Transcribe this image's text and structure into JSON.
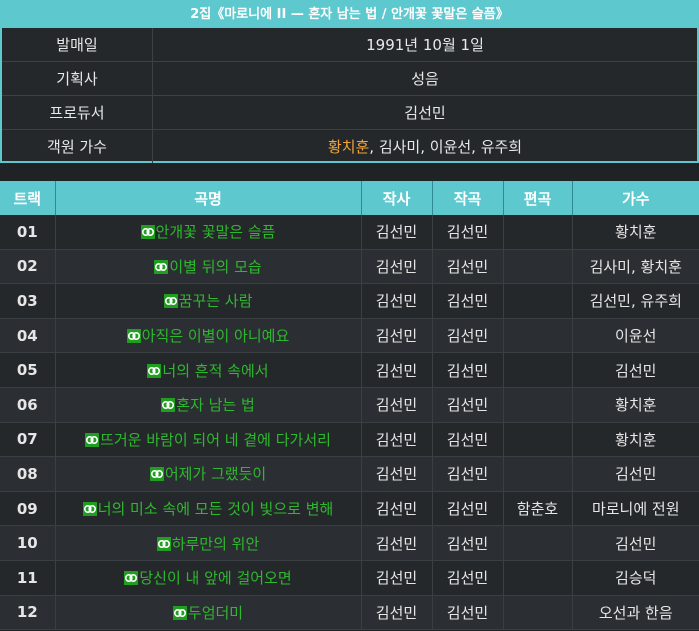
{
  "album": {
    "title": "2집《마로니에 II — 혼자 남는 법 / 안개꽃 꽃말은 슬픔》",
    "info": [
      {
        "label": "발매일",
        "value": "1991년 10월 1일"
      },
      {
        "label": "기획사",
        "value": "성음"
      },
      {
        "label": "프로듀서",
        "value": "김선민"
      }
    ],
    "guest_label": "객원 가수",
    "guest_highlight": "黃치훈",
    "guest_rest": ", 김사미, 이윤선, 유주희"
  },
  "track_table": {
    "headers": [
      "트랙",
      "곡명",
      "작사",
      "작곡",
      "편곡",
      "가수"
    ],
    "rows": [
      {
        "no": "01",
        "title": "안개꽃 꽃말은 슬픔",
        "lyrics": "김선민",
        "composer": "김선민",
        "arranger": "",
        "singer": "황치훈"
      },
      {
        "no": "02",
        "title": "이별 뒤의 모습",
        "lyrics": "김선민",
        "composer": "김선민",
        "arranger": "",
        "singer": "김사미, 황치훈"
      },
      {
        "no": "03",
        "title": "꿈꾸는 사람",
        "lyrics": "김선민",
        "composer": "김선민",
        "arranger": "",
        "singer": "김선민, 유주희"
      },
      {
        "no": "04",
        "title": "아직은 이별이 아니예요",
        "lyrics": "김선민",
        "composer": "김선민",
        "arranger": "",
        "singer": "이윤선"
      },
      {
        "no": "05",
        "title": "너의 흔적 속에서",
        "lyrics": "김선민",
        "composer": "김선민",
        "arranger": "",
        "singer": "김선민"
      },
      {
        "no": "06",
        "title": "혼자 남는 법",
        "lyrics": "김선민",
        "composer": "김선민",
        "arranger": "",
        "singer": "황치훈"
      },
      {
        "no": "07",
        "title": "뜨거운 바람이 되어 네 곁에 다가서리",
        "lyrics": "김선민",
        "composer": "김선민",
        "arranger": "",
        "singer": "황치훈"
      },
      {
        "no": "08",
        "title": "어제가 그랬듯이",
        "lyrics": "김선민",
        "composer": "김선민",
        "arranger": "",
        "singer": "김선민"
      },
      {
        "no": "09",
        "title": "너의 미소 속에 모든 것이 빛으로 변해",
        "lyrics": "김선민",
        "composer": "김선민",
        "arranger": "함춘호",
        "singer": "마로니에 전원"
      },
      {
        "no": "10",
        "title": "하루만의 위안",
        "lyrics": "김선민",
        "composer": "김선민",
        "arranger": "",
        "singer": "김선민"
      },
      {
        "no": "11",
        "title": "당신이 내 앞에 걸어오면",
        "lyrics": "김선민",
        "composer": "김선민",
        "arranger": "",
        "singer": "김승덕"
      },
      {
        "no": "12",
        "title": "두엄더미",
        "lyrics": "김선민",
        "composer": "김선민",
        "arranger": "",
        "singer": "오선과 한음"
      }
    ]
  },
  "colors": {
    "accent": "#5ec8cf",
    "link": "#2eb82e",
    "highlight": "#f0a43a"
  },
  "icons": {
    "song_link": "link-icon"
  }
}
